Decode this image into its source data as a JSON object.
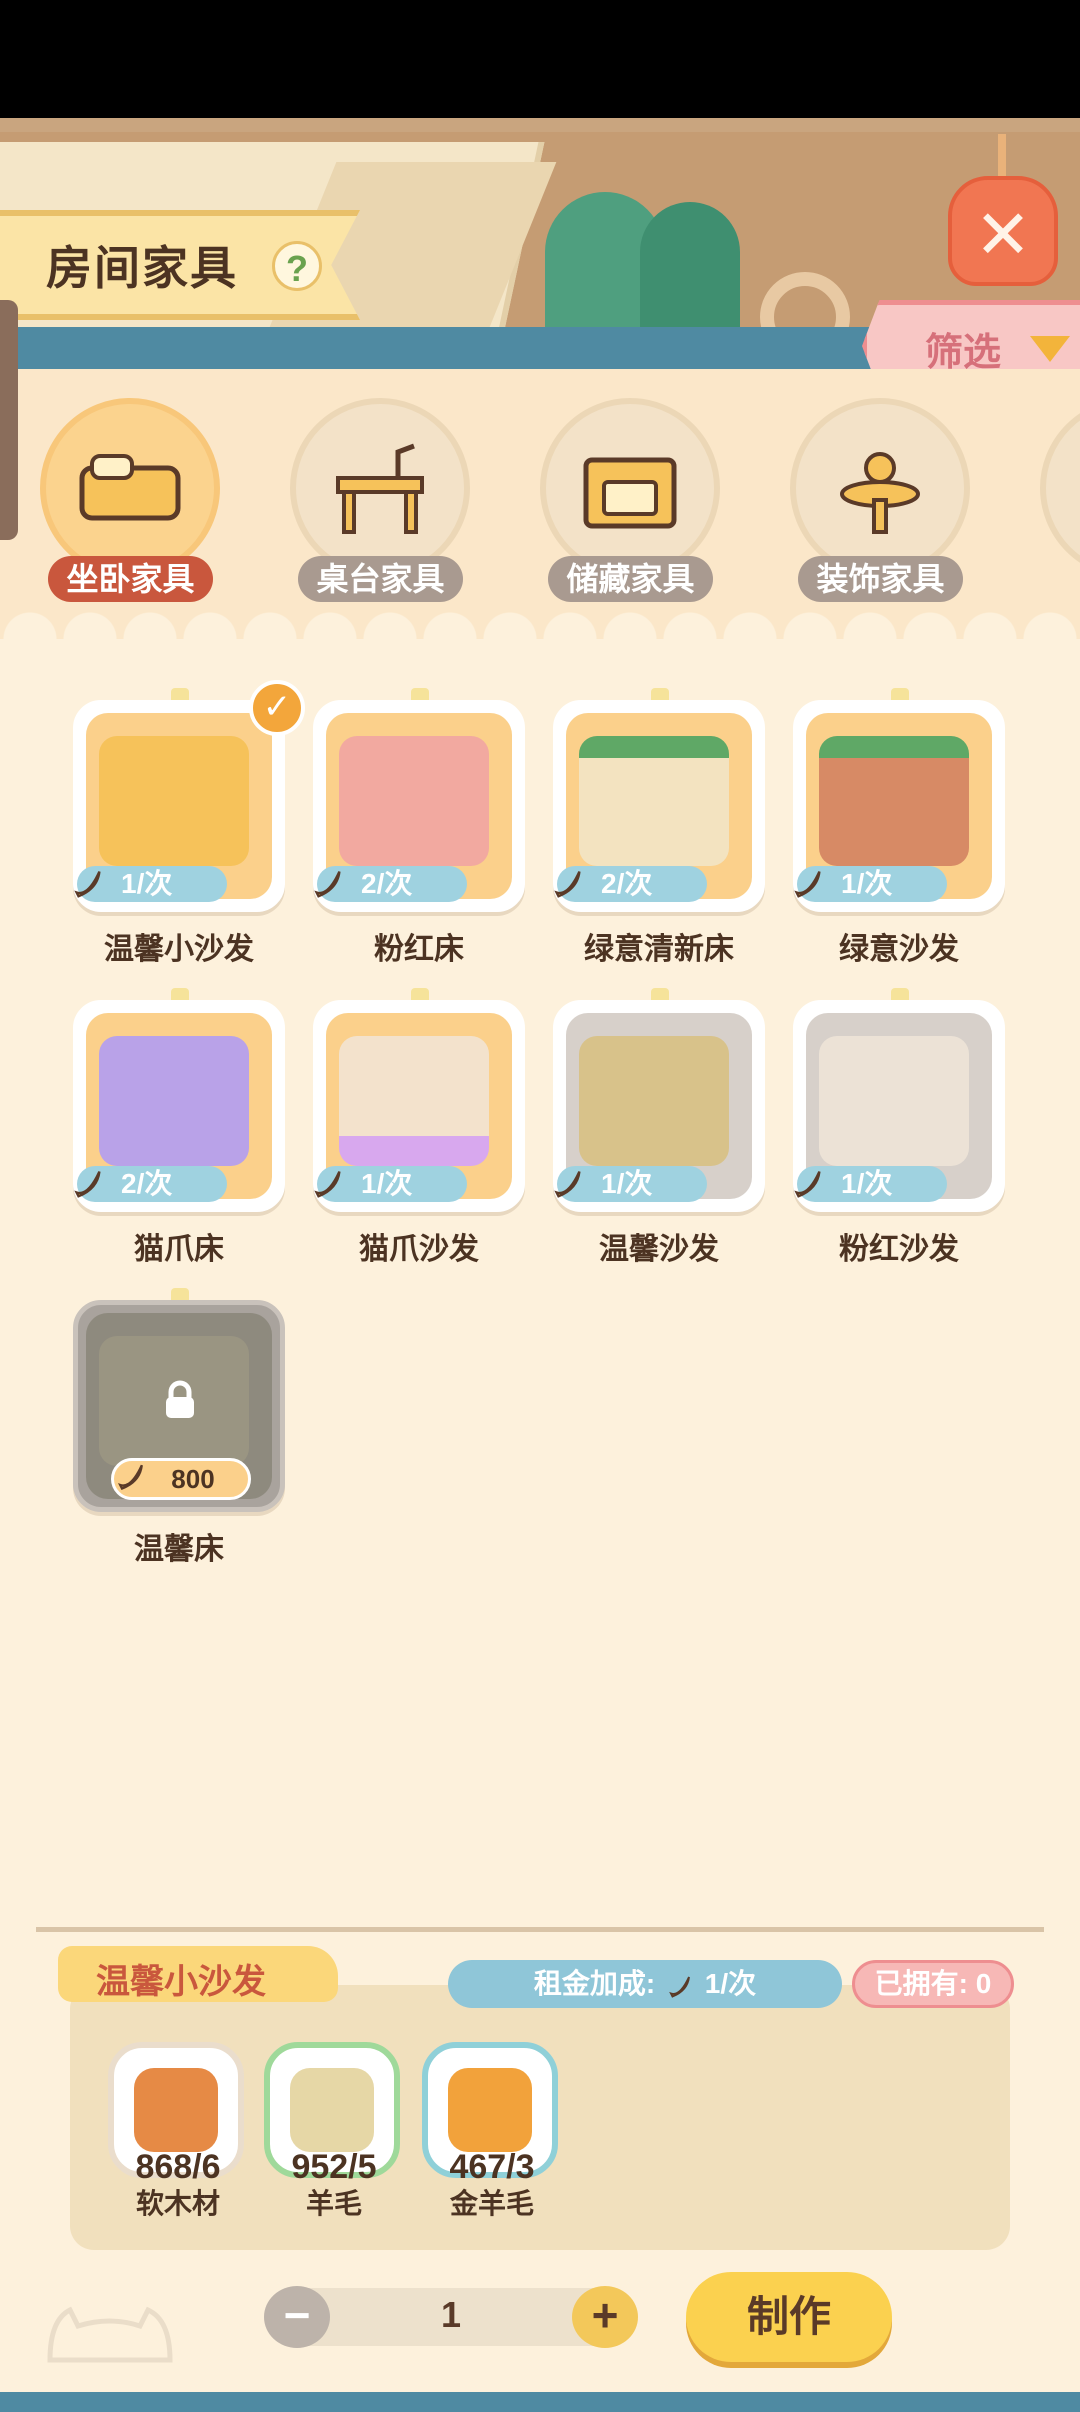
{
  "header": {
    "title": "房间家具",
    "help": "?",
    "filter_label": "筛选",
    "close": "✕"
  },
  "categories": [
    {
      "label": "坐卧家具",
      "active": true
    },
    {
      "label": "桌台家具",
      "active": false
    },
    {
      "label": "储藏家具",
      "active": false
    },
    {
      "label": "装饰家具",
      "active": false
    }
  ],
  "items": [
    {
      "name": "温馨小沙发",
      "rent": "1/次",
      "color": "#f6c25a",
      "selected": true
    },
    {
      "name": "粉红床",
      "rent": "2/次",
      "color": "#f2a9a0"
    },
    {
      "name": "绿意清新床",
      "rent": "2/次",
      "color": "#f3e3c0"
    },
    {
      "name": "绿意沙发",
      "rent": "1/次",
      "color": "#d78a65"
    },
    {
      "name": "猫爪床",
      "rent": "2/次",
      "color": "#b9a2e8"
    },
    {
      "name": "猫爪沙发",
      "rent": "1/次",
      "color": "#f3e2cc"
    },
    {
      "name": "温馨沙发",
      "rent": "1/次",
      "color": "#d8c28a",
      "grey": true
    },
    {
      "name": "粉红沙发",
      "rent": "1/次",
      "color": "#ece2d6",
      "grey": true
    },
    {
      "name": "温馨床",
      "price": "800",
      "locked": true
    }
  ],
  "detail": {
    "title": "温馨小沙发",
    "rent_bonus_label": "租金加成:",
    "rent_bonus_value": "1/次",
    "owned": "已拥有: 0",
    "materials": [
      {
        "count": "868/6",
        "name": "软木材",
        "ring": "#eaddcc",
        "color": "#e68a45"
      },
      {
        "count": "952/5",
        "name": "羊毛",
        "ring": "#9fd99a",
        "color": "#e6d7a6"
      },
      {
        "count": "467/3",
        "name": "金羊毛",
        "ring": "#8fd0d8",
        "color": "#f2a23b"
      }
    ]
  },
  "controls": {
    "minus": "−",
    "quantity": "1",
    "plus": "+",
    "craft": "制作"
  }
}
